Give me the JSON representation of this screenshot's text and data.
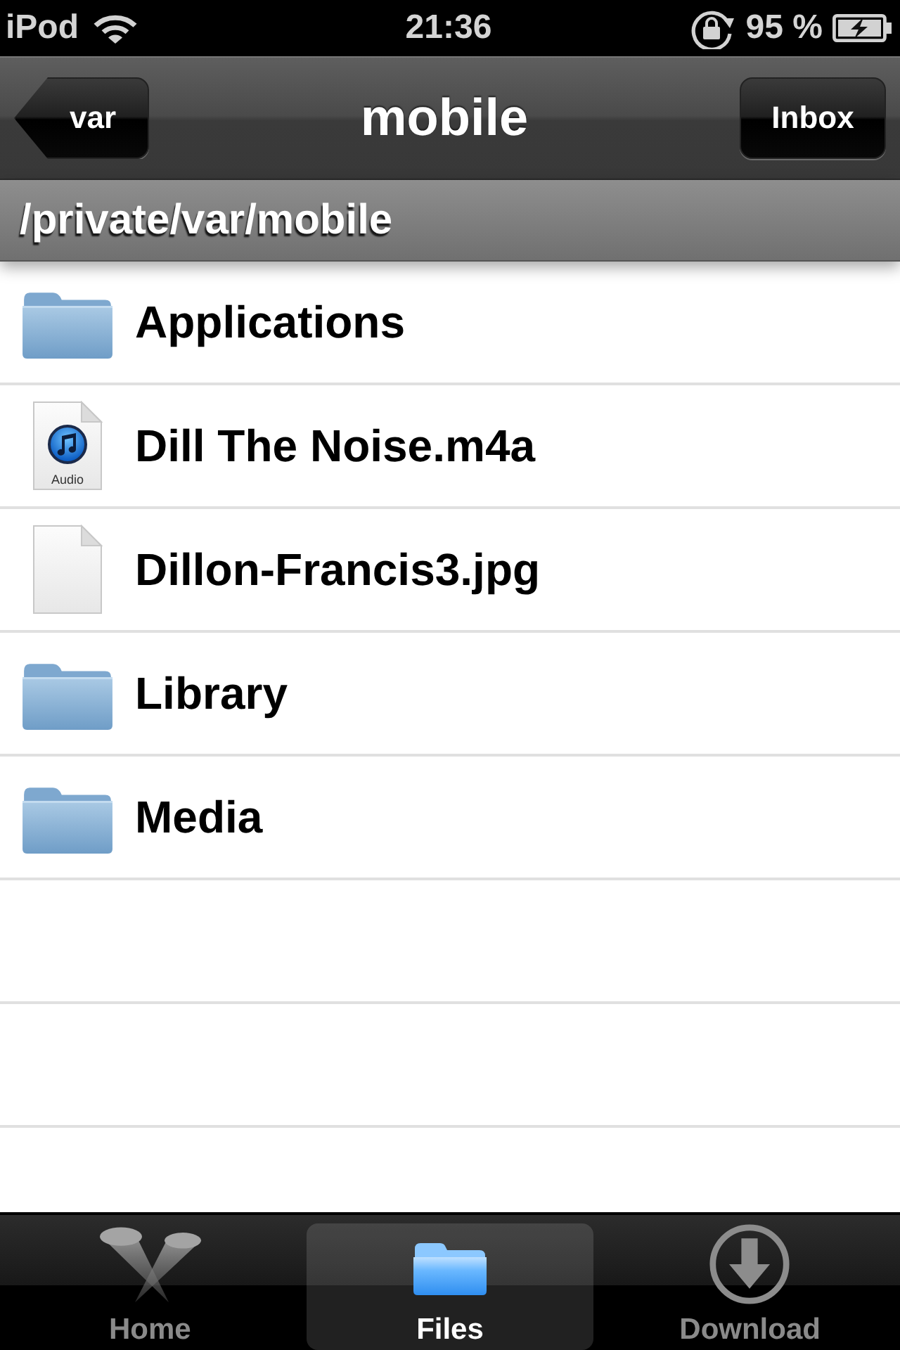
{
  "status_bar": {
    "carrier": "iPod",
    "time": "21:36",
    "battery_text": "95 %",
    "charging": true
  },
  "nav_bar": {
    "back_button": "var",
    "title": "mobile",
    "right_button": "Inbox"
  },
  "path": "/private/var/mobile",
  "files": [
    {
      "name": "Applications",
      "kind": "folder"
    },
    {
      "name": "Dill The Noise.m4a",
      "kind": "audio",
      "icon_label": "Audio"
    },
    {
      "name": "Dillon-Francis3.jpg",
      "kind": "document"
    },
    {
      "name": "Library",
      "kind": "folder"
    },
    {
      "name": "Media",
      "kind": "folder"
    }
  ],
  "tab_bar": [
    {
      "label": "Home",
      "kind": "home",
      "selected": false
    },
    {
      "label": "Files",
      "kind": "files",
      "selected": true
    },
    {
      "label": "Download",
      "kind": "download",
      "selected": false
    }
  ]
}
